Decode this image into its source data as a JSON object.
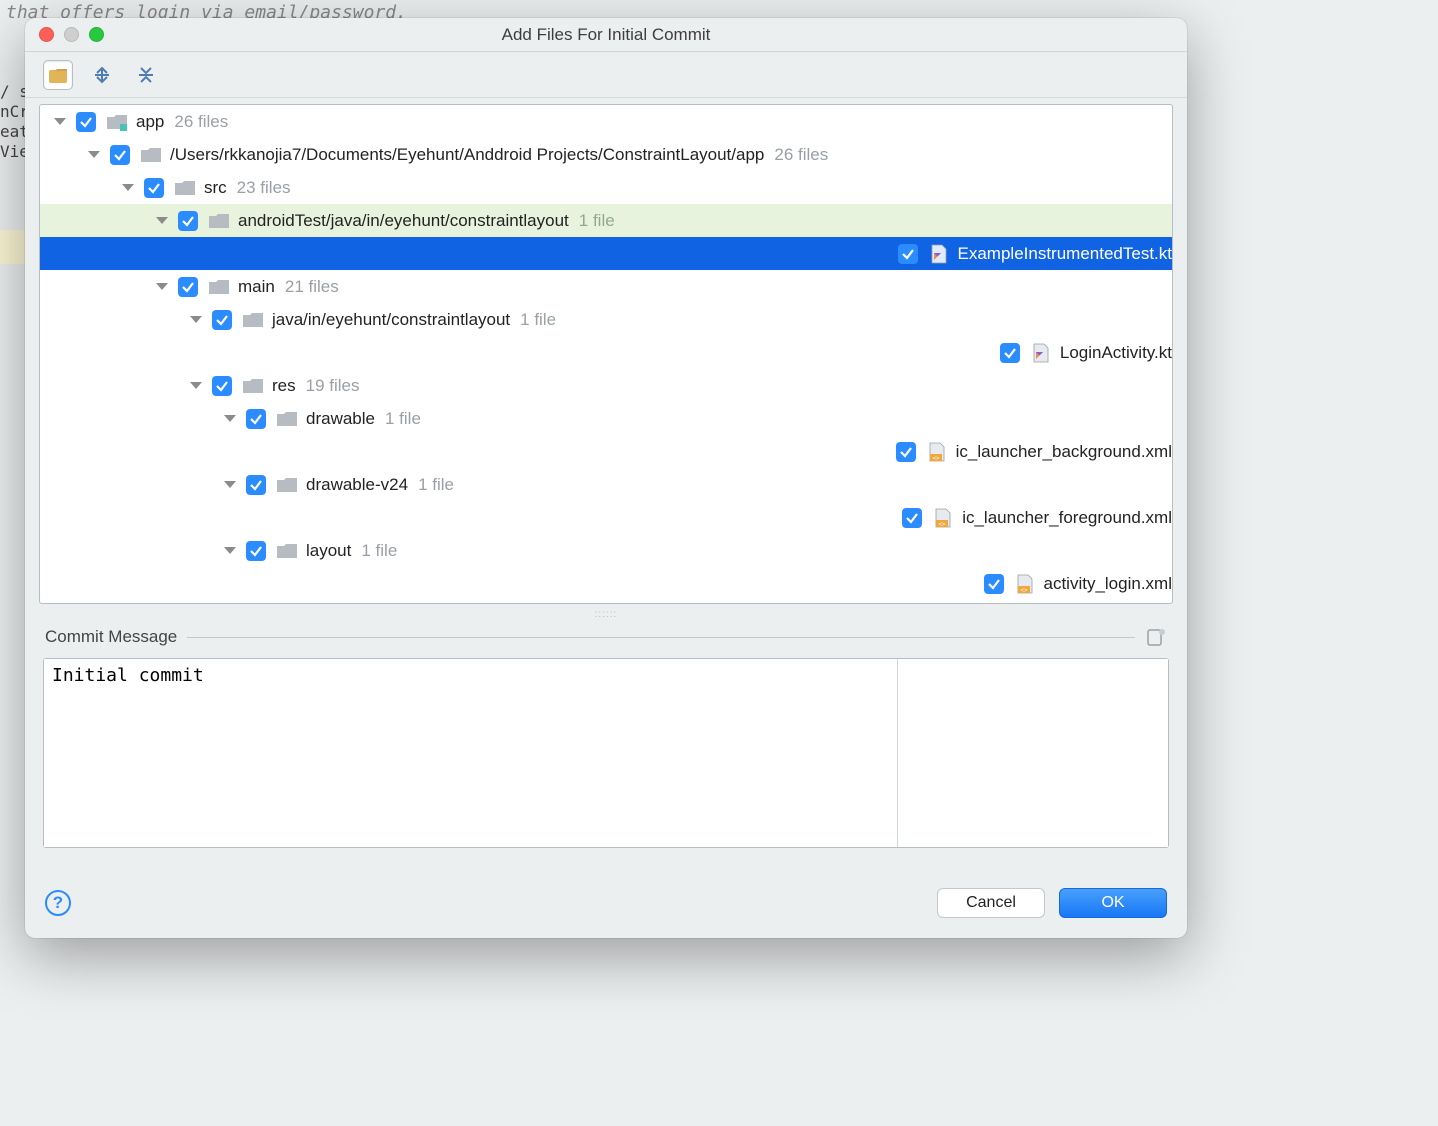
{
  "background": {
    "code_line": "that offers login via email/password.",
    "left_snip": "/ s\nnCr\neat\nVie"
  },
  "dialog": {
    "title": "Add Files For Initial Commit"
  },
  "tree": [
    {
      "indent": 0,
      "disclosure": true,
      "check": true,
      "iconType": "module",
      "label": "app",
      "count": "26 files",
      "state": "normal"
    },
    {
      "indent": 1,
      "disclosure": true,
      "check": true,
      "iconType": "folder",
      "label": "/Users/rkkanojia7/Documents/Eyehunt/Anddroid Projects/ConstraintLayout/app",
      "count": "26 files",
      "state": "normal"
    },
    {
      "indent": 2,
      "disclosure": true,
      "check": true,
      "iconType": "folder",
      "label": "src",
      "count": "23 files",
      "state": "normal"
    },
    {
      "indent": 3,
      "disclosure": true,
      "check": true,
      "iconType": "folder",
      "label": "androidTest/java/in/eyehunt/constraintlayout",
      "count": "1 file",
      "state": "highlight"
    },
    {
      "indent": 4,
      "disclosure": false,
      "check": true,
      "iconType": "kt",
      "label": "ExampleInstrumentedTest.kt",
      "count": "",
      "state": "selected"
    },
    {
      "indent": 3,
      "disclosure": true,
      "check": true,
      "iconType": "folder",
      "label": "main",
      "count": "21 files",
      "state": "normal"
    },
    {
      "indent": 4,
      "disclosure": true,
      "check": true,
      "iconType": "folder",
      "label": "java/in/eyehunt/constraintlayout",
      "count": "1 file",
      "state": "normal"
    },
    {
      "indent": 5,
      "disclosure": false,
      "check": true,
      "iconType": "kt",
      "label": "LoginActivity.kt",
      "count": "",
      "state": "normal"
    },
    {
      "indent": 4,
      "disclosure": true,
      "check": true,
      "iconType": "folder",
      "label": "res",
      "count": "19 files",
      "state": "normal"
    },
    {
      "indent": 5,
      "disclosure": true,
      "check": true,
      "iconType": "folder",
      "label": "drawable",
      "count": "1 file",
      "state": "normal"
    },
    {
      "indent": 6,
      "disclosure": false,
      "check": true,
      "iconType": "xml",
      "label": "ic_launcher_background.xml",
      "count": "",
      "state": "normal"
    },
    {
      "indent": 5,
      "disclosure": true,
      "check": true,
      "iconType": "folder",
      "label": "drawable-v24",
      "count": "1 file",
      "state": "normal"
    },
    {
      "indent": 6,
      "disclosure": false,
      "check": true,
      "iconType": "xml",
      "label": "ic_launcher_foreground.xml",
      "count": "",
      "state": "normal"
    },
    {
      "indent": 5,
      "disclosure": true,
      "check": true,
      "iconType": "folder",
      "label": "layout",
      "count": "1 file",
      "state": "normal"
    },
    {
      "indent": 6,
      "disclosure": false,
      "check": true,
      "iconType": "xml",
      "label": "activity_login.xml",
      "count": "",
      "state": "normal"
    }
  ],
  "commit": {
    "section_label": "Commit Message",
    "message": "Initial commit"
  },
  "buttons": {
    "cancel": "Cancel",
    "ok": "OK"
  }
}
